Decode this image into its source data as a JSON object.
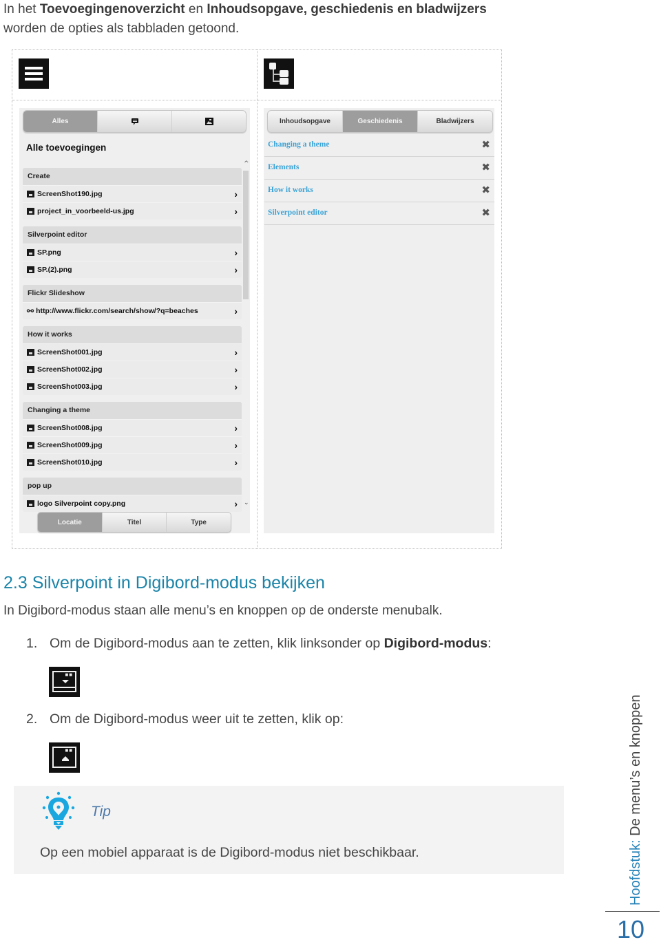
{
  "intro": {
    "t1": "In het ",
    "b1": "Toevoegingenoverzicht",
    "t2": " en ",
    "b2": "Inhoudsopgave, geschiedenis en bladwijzers",
    "t3": "worden de opties als tabbladen getoond."
  },
  "left_panel": {
    "icon": "hamburger-menu-icon",
    "tabs": [
      {
        "label": "Alles",
        "active": true
      },
      {
        "label": "",
        "icon": "comment-icon",
        "active": false
      },
      {
        "label": "",
        "icon": "image-icon",
        "active": false
      }
    ],
    "title": "Alle toevoegingen",
    "groups": [
      {
        "name": "Create",
        "items": [
          {
            "icon": "image-icon",
            "label": "ScreenShot190.jpg"
          },
          {
            "icon": "image-icon",
            "label": "project_in_voorbeeld-us.jpg"
          }
        ]
      },
      {
        "name": "Silverpoint editor",
        "items": [
          {
            "icon": "image-icon",
            "label": "SP.png"
          },
          {
            "icon": "image-icon",
            "label": "SP.(2).png"
          }
        ]
      },
      {
        "name": "Flickr Slideshow",
        "items": [
          {
            "icon": "link-icon",
            "label": "http://www.flickr.com/search/show/?q=beaches"
          }
        ]
      },
      {
        "name": "How it works",
        "items": [
          {
            "icon": "image-icon",
            "label": "ScreenShot001.jpg"
          },
          {
            "icon": "image-icon",
            "label": "ScreenShot002.jpg"
          },
          {
            "icon": "image-icon",
            "label": "ScreenShot003.jpg"
          }
        ]
      },
      {
        "name": "Changing a theme",
        "items": [
          {
            "icon": "image-icon",
            "label": "ScreenShot008.jpg"
          },
          {
            "icon": "image-icon",
            "label": "ScreenShot009.jpg"
          },
          {
            "icon": "image-icon",
            "label": "ScreenShot010.jpg"
          }
        ]
      },
      {
        "name": "pop up",
        "items": [
          {
            "icon": "image-icon",
            "label": "logo Silverpoint copy.png"
          }
        ]
      }
    ],
    "sort_tabs": [
      {
        "label": "Locatie",
        "active": true
      },
      {
        "label": "Titel",
        "active": false
      },
      {
        "label": "Type",
        "active": false
      }
    ]
  },
  "right_panel": {
    "icon": "tree-structure-icon",
    "tabs": [
      {
        "label": "Inhoudsopgave",
        "active": false
      },
      {
        "label": "Geschiedenis",
        "active": true
      },
      {
        "label": "Bladwijzers",
        "active": false
      }
    ],
    "history": [
      "Changing a theme",
      "Elements",
      "How it works",
      "Silverpoint editor"
    ]
  },
  "section": {
    "heading": "2.3 Silverpoint in Digibord-modus bekijken",
    "intro": "In Digibord-modus staan alle menu’s en knoppen op de onderste menubalk.",
    "steps": [
      {
        "num": "1.",
        "text": "Om de Digibord-modus aan te zetten, klik linksonder op ",
        "bold": "Digibord-modus",
        "after": ":"
      },
      {
        "num": "2.",
        "text": "Om de Digibord-modus weer uit te zetten, klik op:",
        "bold": "",
        "after": ""
      }
    ]
  },
  "tip": {
    "label": "Tip",
    "text": "Op een mobiel apparaat is de Digibord-modus niet beschikbaar.",
    "accent": "#1aa7e0"
  },
  "footer": {
    "chapter_prefix": "Hoofdstuk:",
    "chapter_title": " De menu’s en knoppen",
    "page": "10"
  }
}
